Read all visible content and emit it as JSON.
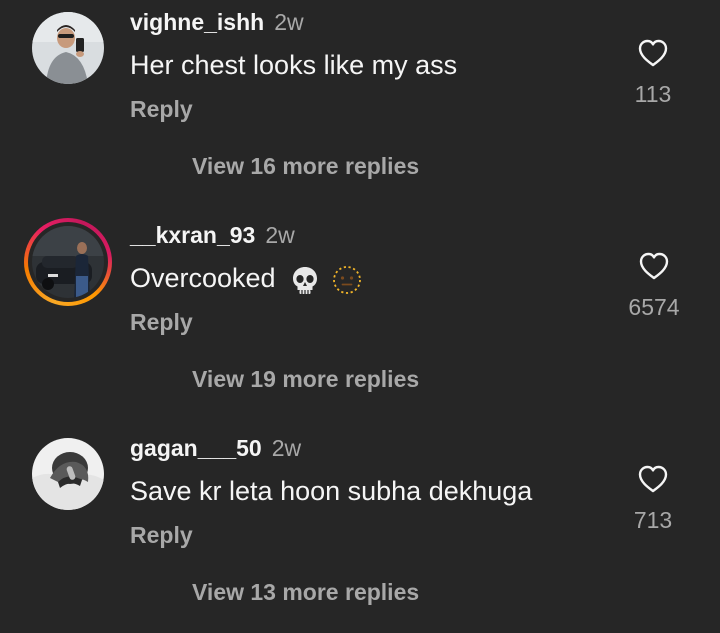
{
  "comments": [
    {
      "username": "vighne_ishh",
      "time": "2w",
      "text": "Her chest looks like my ass",
      "reply_label": "Reply",
      "more_replies": "View 16 more replies",
      "likes": "113",
      "has_story_ring": false,
      "emojis": []
    },
    {
      "username": "__kxran_93",
      "time": "2w",
      "text": "Overcooked",
      "reply_label": "Reply",
      "more_replies": "View 19 more replies",
      "likes": "6574",
      "has_story_ring": true,
      "emojis": [
        "skull-emoji",
        "dotted-face-emoji"
      ]
    },
    {
      "username": "gagan___50",
      "time": "2w",
      "text": "Save kr leta hoon subha dekhuga",
      "reply_label": "Reply",
      "more_replies": "View 13 more replies",
      "likes": "713",
      "has_story_ring": false,
      "emojis": []
    }
  ],
  "icons": {
    "like": "heart-outline-icon"
  },
  "colors": {
    "background": "#262626",
    "primary_text": "#f5f5f5",
    "secondary_text": "#a8a8a8",
    "story_ring_start": "#f9a825",
    "story_ring_end": "#e91e63"
  }
}
